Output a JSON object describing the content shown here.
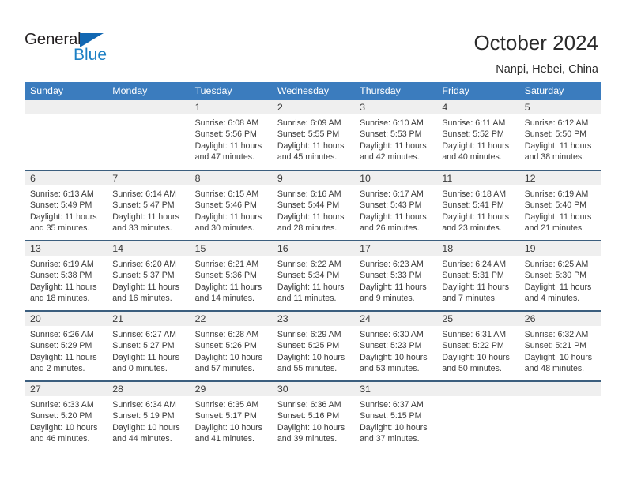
{
  "brand": {
    "name_top": "General",
    "name_bottom": "Blue",
    "triangle_color": "#1268b3",
    "blue_text_color": "#1b7fc4"
  },
  "header": {
    "title": "October 2024",
    "subtitle": "Nanpi, Hebei, China"
  },
  "theme": {
    "header_bg": "#3b7cbe",
    "row_divider": "#3b5e7e",
    "daynum_band_bg": "#efefef",
    "text": "#3a3a3a"
  },
  "weekdays": [
    "Sunday",
    "Monday",
    "Tuesday",
    "Wednesday",
    "Thursday",
    "Friday",
    "Saturday"
  ],
  "weeks": [
    [
      {
        "day": ""
      },
      {
        "day": ""
      },
      {
        "day": "1",
        "sunrise": "Sunrise: 6:08 AM",
        "sunset": "Sunset: 5:56 PM",
        "daylight1": "Daylight: 11 hours",
        "daylight2": "and 47 minutes."
      },
      {
        "day": "2",
        "sunrise": "Sunrise: 6:09 AM",
        "sunset": "Sunset: 5:55 PM",
        "daylight1": "Daylight: 11 hours",
        "daylight2": "and 45 minutes."
      },
      {
        "day": "3",
        "sunrise": "Sunrise: 6:10 AM",
        "sunset": "Sunset: 5:53 PM",
        "daylight1": "Daylight: 11 hours",
        "daylight2": "and 42 minutes."
      },
      {
        "day": "4",
        "sunrise": "Sunrise: 6:11 AM",
        "sunset": "Sunset: 5:52 PM",
        "daylight1": "Daylight: 11 hours",
        "daylight2": "and 40 minutes."
      },
      {
        "day": "5",
        "sunrise": "Sunrise: 6:12 AM",
        "sunset": "Sunset: 5:50 PM",
        "daylight1": "Daylight: 11 hours",
        "daylight2": "and 38 minutes."
      }
    ],
    [
      {
        "day": "6",
        "sunrise": "Sunrise: 6:13 AM",
        "sunset": "Sunset: 5:49 PM",
        "daylight1": "Daylight: 11 hours",
        "daylight2": "and 35 minutes."
      },
      {
        "day": "7",
        "sunrise": "Sunrise: 6:14 AM",
        "sunset": "Sunset: 5:47 PM",
        "daylight1": "Daylight: 11 hours",
        "daylight2": "and 33 minutes."
      },
      {
        "day": "8",
        "sunrise": "Sunrise: 6:15 AM",
        "sunset": "Sunset: 5:46 PM",
        "daylight1": "Daylight: 11 hours",
        "daylight2": "and 30 minutes."
      },
      {
        "day": "9",
        "sunrise": "Sunrise: 6:16 AM",
        "sunset": "Sunset: 5:44 PM",
        "daylight1": "Daylight: 11 hours",
        "daylight2": "and 28 minutes."
      },
      {
        "day": "10",
        "sunrise": "Sunrise: 6:17 AM",
        "sunset": "Sunset: 5:43 PM",
        "daylight1": "Daylight: 11 hours",
        "daylight2": "and 26 minutes."
      },
      {
        "day": "11",
        "sunrise": "Sunrise: 6:18 AM",
        "sunset": "Sunset: 5:41 PM",
        "daylight1": "Daylight: 11 hours",
        "daylight2": "and 23 minutes."
      },
      {
        "day": "12",
        "sunrise": "Sunrise: 6:19 AM",
        "sunset": "Sunset: 5:40 PM",
        "daylight1": "Daylight: 11 hours",
        "daylight2": "and 21 minutes."
      }
    ],
    [
      {
        "day": "13",
        "sunrise": "Sunrise: 6:19 AM",
        "sunset": "Sunset: 5:38 PM",
        "daylight1": "Daylight: 11 hours",
        "daylight2": "and 18 minutes."
      },
      {
        "day": "14",
        "sunrise": "Sunrise: 6:20 AM",
        "sunset": "Sunset: 5:37 PM",
        "daylight1": "Daylight: 11 hours",
        "daylight2": "and 16 minutes."
      },
      {
        "day": "15",
        "sunrise": "Sunrise: 6:21 AM",
        "sunset": "Sunset: 5:36 PM",
        "daylight1": "Daylight: 11 hours",
        "daylight2": "and 14 minutes."
      },
      {
        "day": "16",
        "sunrise": "Sunrise: 6:22 AM",
        "sunset": "Sunset: 5:34 PM",
        "daylight1": "Daylight: 11 hours",
        "daylight2": "and 11 minutes."
      },
      {
        "day": "17",
        "sunrise": "Sunrise: 6:23 AM",
        "sunset": "Sunset: 5:33 PM",
        "daylight1": "Daylight: 11 hours",
        "daylight2": "and 9 minutes."
      },
      {
        "day": "18",
        "sunrise": "Sunrise: 6:24 AM",
        "sunset": "Sunset: 5:31 PM",
        "daylight1": "Daylight: 11 hours",
        "daylight2": "and 7 minutes."
      },
      {
        "day": "19",
        "sunrise": "Sunrise: 6:25 AM",
        "sunset": "Sunset: 5:30 PM",
        "daylight1": "Daylight: 11 hours",
        "daylight2": "and 4 minutes."
      }
    ],
    [
      {
        "day": "20",
        "sunrise": "Sunrise: 6:26 AM",
        "sunset": "Sunset: 5:29 PM",
        "daylight1": "Daylight: 11 hours",
        "daylight2": "and 2 minutes."
      },
      {
        "day": "21",
        "sunrise": "Sunrise: 6:27 AM",
        "sunset": "Sunset: 5:27 PM",
        "daylight1": "Daylight: 11 hours",
        "daylight2": "and 0 minutes."
      },
      {
        "day": "22",
        "sunrise": "Sunrise: 6:28 AM",
        "sunset": "Sunset: 5:26 PM",
        "daylight1": "Daylight: 10 hours",
        "daylight2": "and 57 minutes."
      },
      {
        "day": "23",
        "sunrise": "Sunrise: 6:29 AM",
        "sunset": "Sunset: 5:25 PM",
        "daylight1": "Daylight: 10 hours",
        "daylight2": "and 55 minutes."
      },
      {
        "day": "24",
        "sunrise": "Sunrise: 6:30 AM",
        "sunset": "Sunset: 5:23 PM",
        "daylight1": "Daylight: 10 hours",
        "daylight2": "and 53 minutes."
      },
      {
        "day": "25",
        "sunrise": "Sunrise: 6:31 AM",
        "sunset": "Sunset: 5:22 PM",
        "daylight1": "Daylight: 10 hours",
        "daylight2": "and 50 minutes."
      },
      {
        "day": "26",
        "sunrise": "Sunrise: 6:32 AM",
        "sunset": "Sunset: 5:21 PM",
        "daylight1": "Daylight: 10 hours",
        "daylight2": "and 48 minutes."
      }
    ],
    [
      {
        "day": "27",
        "sunrise": "Sunrise: 6:33 AM",
        "sunset": "Sunset: 5:20 PM",
        "daylight1": "Daylight: 10 hours",
        "daylight2": "and 46 minutes."
      },
      {
        "day": "28",
        "sunrise": "Sunrise: 6:34 AM",
        "sunset": "Sunset: 5:19 PM",
        "daylight1": "Daylight: 10 hours",
        "daylight2": "and 44 minutes."
      },
      {
        "day": "29",
        "sunrise": "Sunrise: 6:35 AM",
        "sunset": "Sunset: 5:17 PM",
        "daylight1": "Daylight: 10 hours",
        "daylight2": "and 41 minutes."
      },
      {
        "day": "30",
        "sunrise": "Sunrise: 6:36 AM",
        "sunset": "Sunset: 5:16 PM",
        "daylight1": "Daylight: 10 hours",
        "daylight2": "and 39 minutes."
      },
      {
        "day": "31",
        "sunrise": "Sunrise: 6:37 AM",
        "sunset": "Sunset: 5:15 PM",
        "daylight1": "Daylight: 10 hours",
        "daylight2": "and 37 minutes."
      },
      {
        "day": ""
      },
      {
        "day": ""
      }
    ]
  ]
}
